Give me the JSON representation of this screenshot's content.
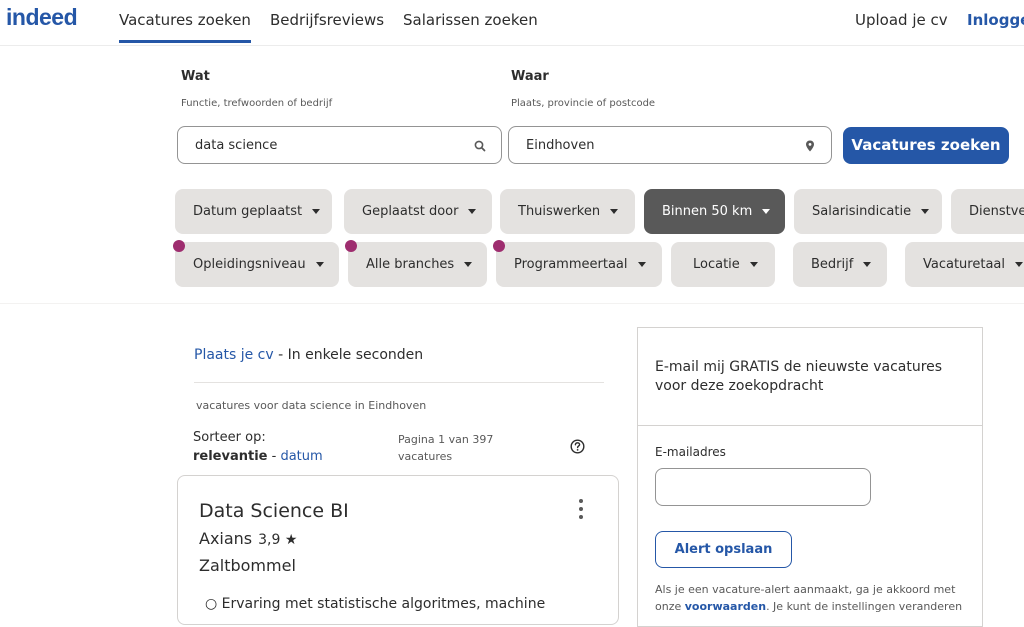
{
  "header": {
    "logo": "indeed",
    "nav": [
      "Vacatures zoeken",
      "Bedrijfsreviews",
      "Salarissen zoeken"
    ],
    "upload": "Upload je cv",
    "login": "Inlogge"
  },
  "search": {
    "what_label": "Wat",
    "what_hint": "Functie, trefwoorden of bedrijf",
    "what_value": "data science",
    "where_label": "Waar",
    "where_hint": "Plaats, provincie of postcode",
    "where_value": "Eindhoven",
    "button": "Vacatures zoeken"
  },
  "filters": {
    "row1": [
      "Datum geplaatst",
      "Geplaatst door",
      "Thuiswerken",
      "Binnen 50 km",
      "Salarisindicatie",
      "Dienstve"
    ],
    "row2": [
      "Opleidingsniveau",
      "Alle branches",
      "Programmeertaal",
      "Locatie",
      "Bedrijf",
      "Vacaturetaal"
    ]
  },
  "results": {
    "cv_link": "Plaats je cv",
    "cv_rest": " - In enkele seconden",
    "subtitle": "vacatures voor data science in Eindhoven",
    "sort_label": "Sorteer op:",
    "sort_active": "relevantie",
    "sort_sep": " - ",
    "sort_other": "datum",
    "pagination": "Pagina 1 van 397 vacatures"
  },
  "job": {
    "title": "Data Science BI",
    "company": "Axians",
    "rating": "3,9 ★",
    "location": "Zaltbommel",
    "bullet": "○  Ervaring met statistische algoritmes, machine"
  },
  "alert": {
    "heading": "E-mail mij GRATIS de nieuwste vacatures voor deze zoekopdracht",
    "email_label": "E-mailadres",
    "button": "Alert opslaan",
    "note_1": "Als je een vacature-alert aanmaakt, ga je akkoord met",
    "note_2_prefix": "onze ",
    "note_link": "voorwaarden",
    "note_2_suffix": ". Je kunt de instellingen veranderen"
  },
  "colors": {
    "brand": "#2557a7",
    "chip": "#e4e2e0",
    "chip_active": "#595959",
    "dot": "#9e2d6f"
  }
}
